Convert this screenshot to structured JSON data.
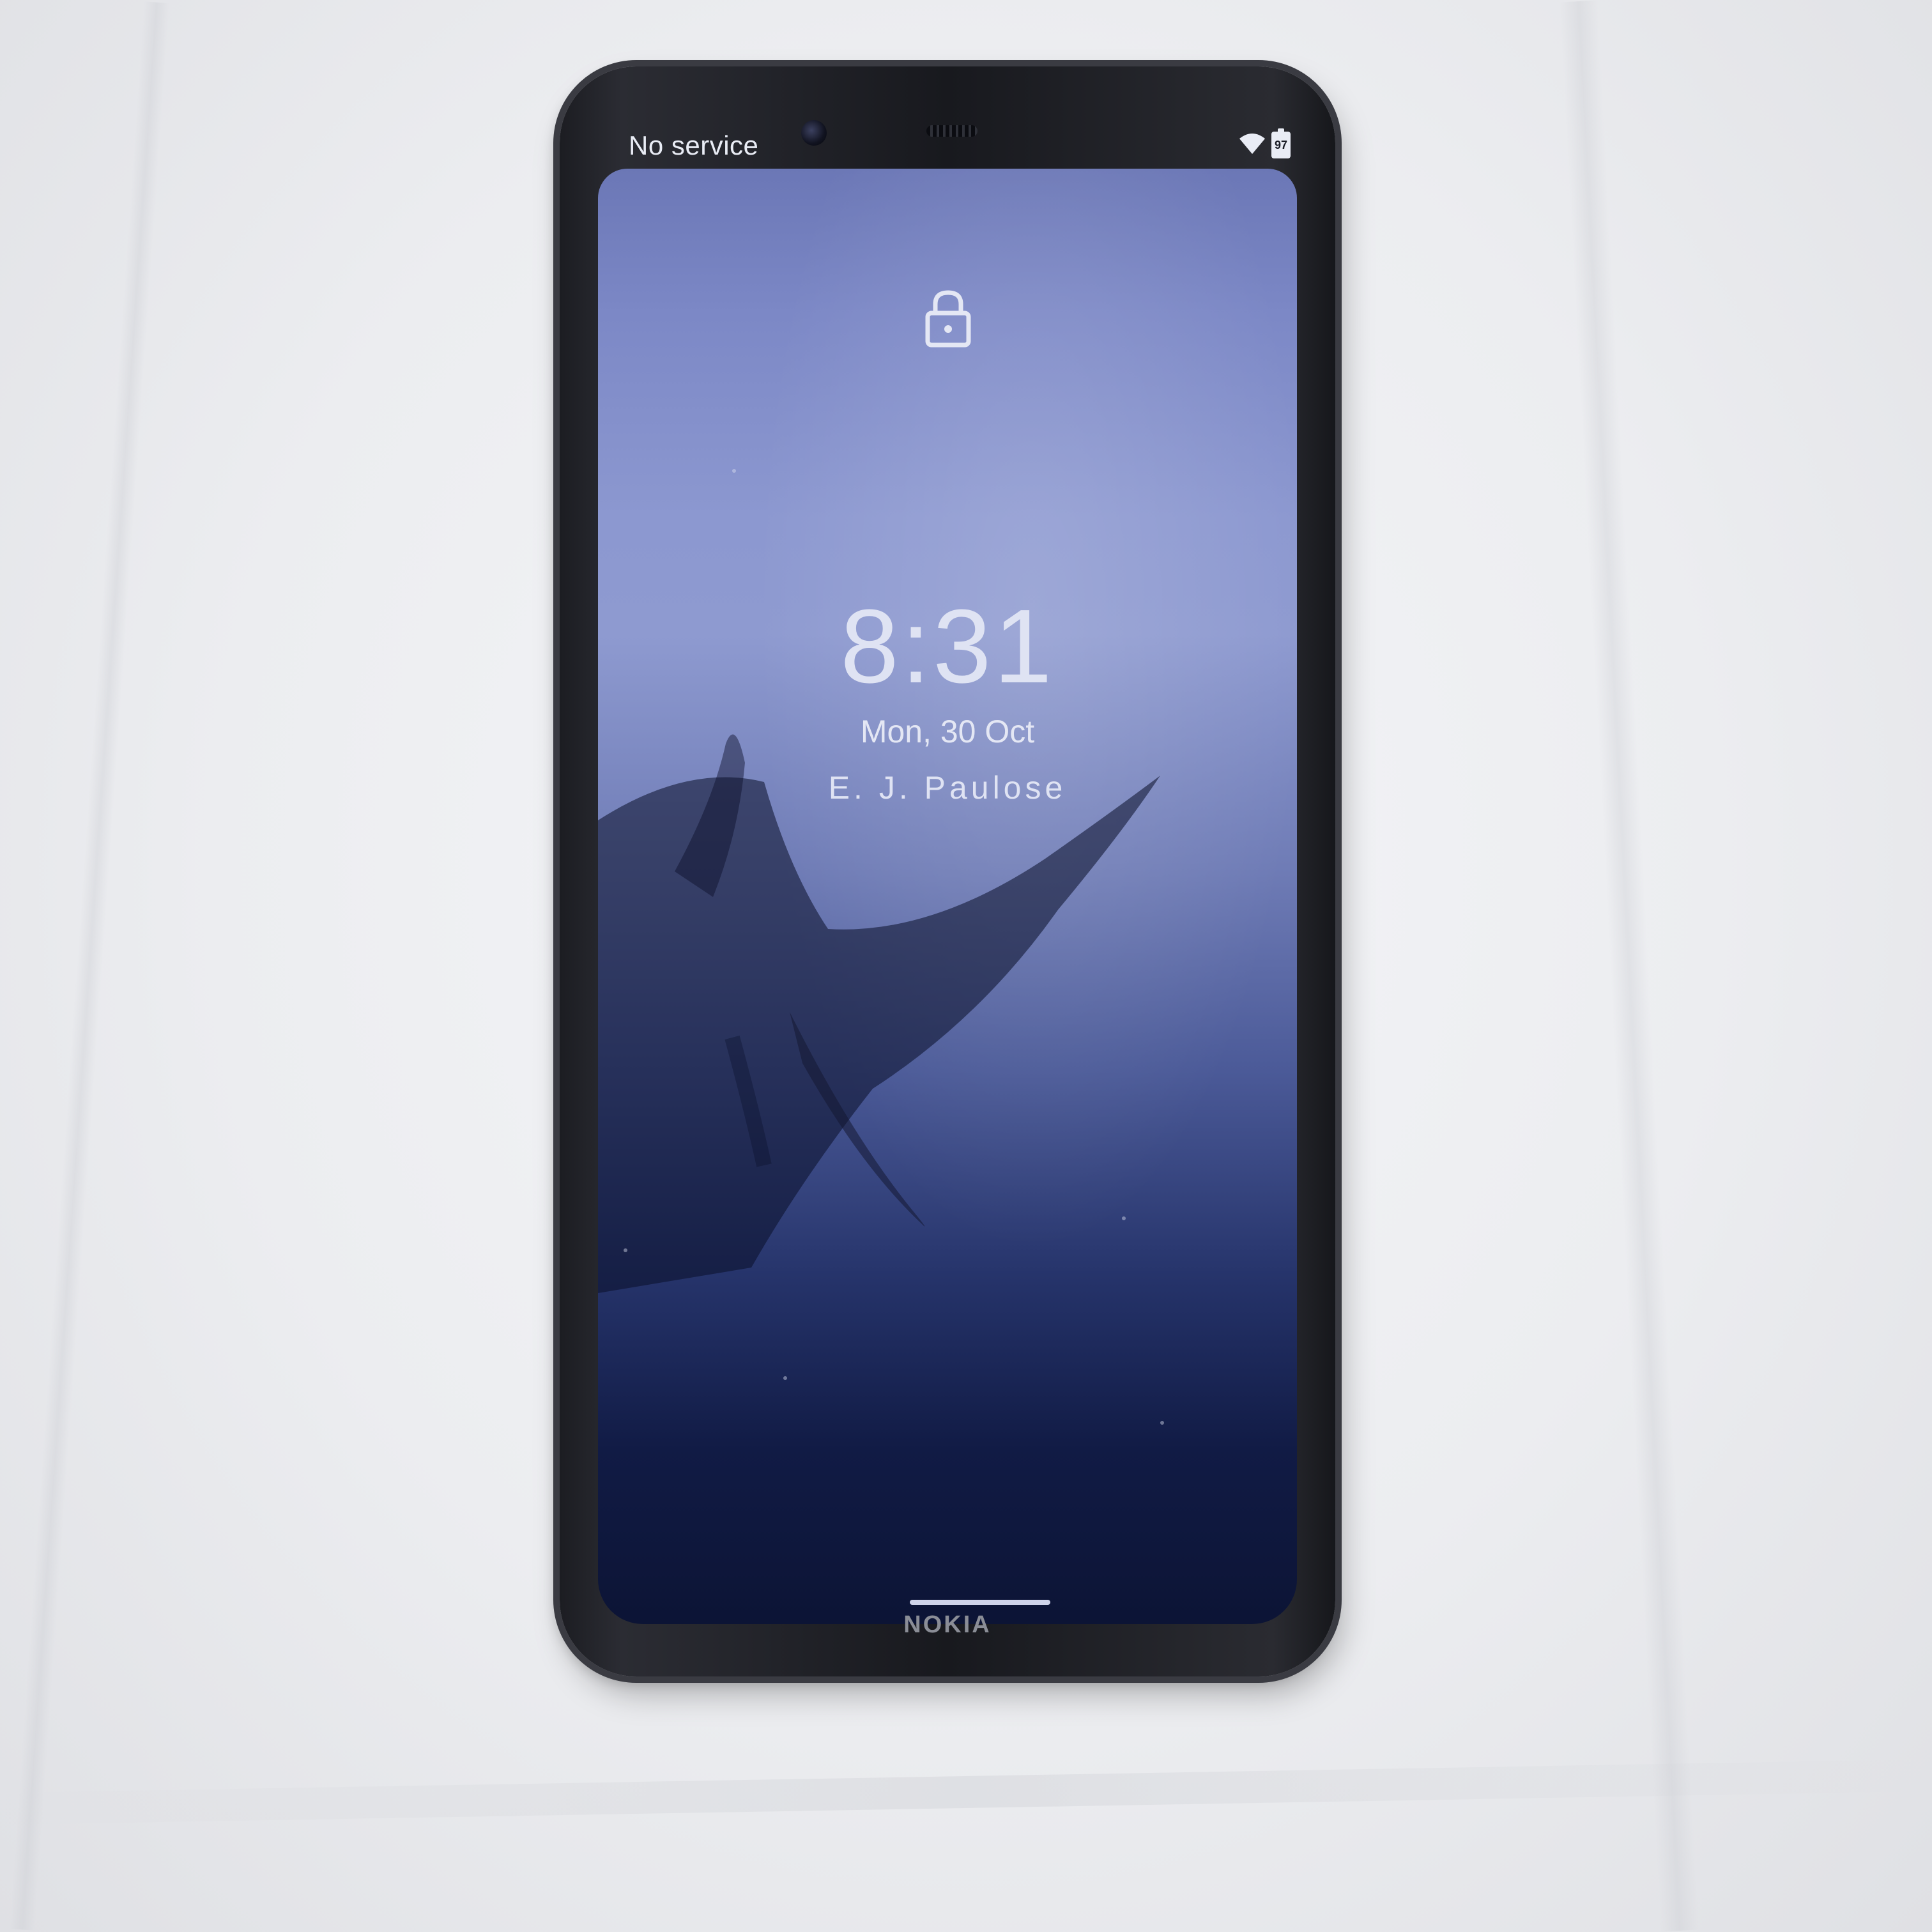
{
  "status_bar": {
    "carrier_text": "No service",
    "battery_level": "97",
    "icons": [
      "wifi-icon",
      "battery-icon"
    ]
  },
  "lock_screen": {
    "lock_icon": "lock-icon",
    "time": "8:31",
    "date": "Mon, 30 Oct",
    "owner_info": "E. J. Paulose"
  },
  "device": {
    "brand": "NOKIA"
  },
  "colors": {
    "screen_top": "#8c98d0",
    "screen_bottom": "#0c1435",
    "text": "#dfe3f3",
    "phone_body": "#1c1d22",
    "background": "#ecedf0"
  }
}
